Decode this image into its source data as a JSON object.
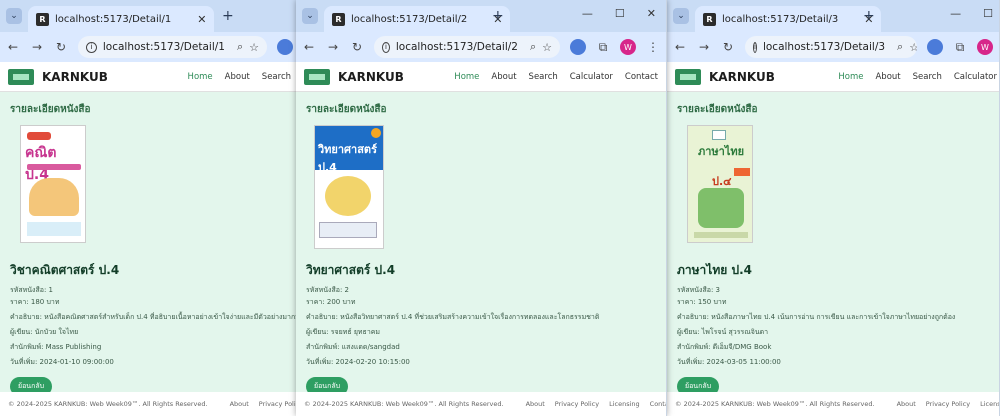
{
  "browser": {
    "tab_search_glyph": "⌄",
    "favicon_letter": "R"
  },
  "site": {
    "brand": "KARNKUB",
    "nav": [
      "Home",
      "About",
      "Search",
      "Calculator",
      "Contact"
    ],
    "heading": "รายละเอียดหนังสือ",
    "back_label": "ย้อนกลับ",
    "footer_copy": "© 2024-2025 KARNKUB: Web Week09™. All Rights Reserved.",
    "footer_links": [
      "About",
      "Privacy Policy",
      "Licensing",
      "Contact"
    ]
  },
  "windows": [
    {
      "tab_title": "localhost:5173/Detail/1",
      "url": "localhost:5173/Detail/1",
      "cover_text": "คณิต ป.4",
      "book_title": "วิชาคณิตศาสตร์ ป.4",
      "rows": [
        "รหัสหนังสือ: 1",
        "ราคา: 180 บาท",
        "คำอธิบาย: หนังสือคณิตศาสตร์สำหรับเด็ก ป.4 ที่อธิบายเนื้อหาอย่างเข้าใจง่ายและมีตัวอย่างมากมาย",
        "ผู้เขียน: นักบัวย ใจไทย",
        "สำนักพิมพ์: Mass Publishing",
        "วันที่เพิ่ม: 2024-01-10 09:00:00"
      ]
    },
    {
      "tab_title": "localhost:5173/Detail/2",
      "url": "localhost:5173/Detail/2",
      "cover_text": "วิทยาศาสตร์ ป.4",
      "book_title": "วิทยาศาสตร์ ป.4",
      "rows": [
        "รหัสหนังสือ: 2",
        "ราคา: 200 บาท",
        "คำอธิบาย: หนังสือวิทยาศาสตร์ ป.4 ที่ช่วยเสริมสร้างความเข้าใจเรื่องการทดลองและโลกธรรมชาติ",
        "ผู้เขียน: รจยทธ์ ยุทธาคม",
        "สำนักพิมพ์: แสงแดด/sangdad",
        "วันที่เพิ่ม: 2024-02-20 10:15:00"
      ]
    },
    {
      "tab_title": "localhost:5173/Detail/3",
      "url": "localhost:5173/Detail/3",
      "cover_text": "ภาษาไทย",
      "cover_grade": "ป.๔",
      "book_title": "ภาษาไทย ป.4",
      "rows": [
        "รหัสหนังสือ: 3",
        "ราคา: 150 บาท",
        "คำอธิบาย: หนังสือภาษาไทย ป.4 เน้นการอ่าน การเขียน และการเข้าใจภาษาไทยอย่างถูกต้อง",
        "ผู้เขียน: ไพโรจน์ สุวรรณจินดา",
        "สำนักพิมพ์: ดีเอ็มจี/DMG Book",
        "วันที่เพิ่ม: 2024-03-05 11:00:00"
      ]
    }
  ]
}
